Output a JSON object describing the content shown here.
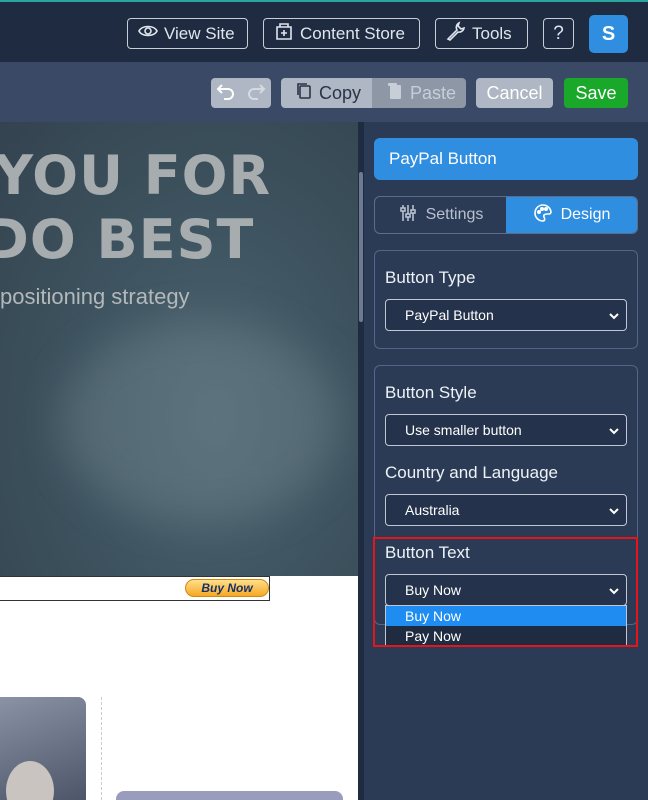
{
  "topbar": {
    "view_site": "View Site",
    "content_store": "Content Store",
    "tools": "Tools",
    "help": "?",
    "avatar_initial": "S"
  },
  "toolbar": {
    "copy": "Copy",
    "paste": "Paste",
    "cancel": "Cancel",
    "save": "Save"
  },
  "canvas": {
    "hero_line1": "YOU FOR",
    "hero_line2": "DO BEST",
    "hero_sub": "positioning strategy",
    "paypal_button_label": "Buy Now"
  },
  "panel": {
    "title": "PayPal Button",
    "tabs": [
      {
        "label": "Settings",
        "active": false
      },
      {
        "label": "Design",
        "active": true
      }
    ],
    "button_type": {
      "label": "Button Type",
      "value": "PayPal Button"
    },
    "button_style": {
      "label": "Button Style",
      "value": "Use smaller button"
    },
    "country_language": {
      "label": "Country and Language",
      "value": "Australia"
    },
    "button_text": {
      "label": "Button Text",
      "value": "Buy Now",
      "options": [
        {
          "label": "Buy Now",
          "highlighted": true
        },
        {
          "label": "Pay Now",
          "highlighted": false
        }
      ]
    }
  },
  "colors": {
    "accent": "#2f8ee0",
    "save": "#1aa82a",
    "highlight_box": "#e8141c"
  }
}
